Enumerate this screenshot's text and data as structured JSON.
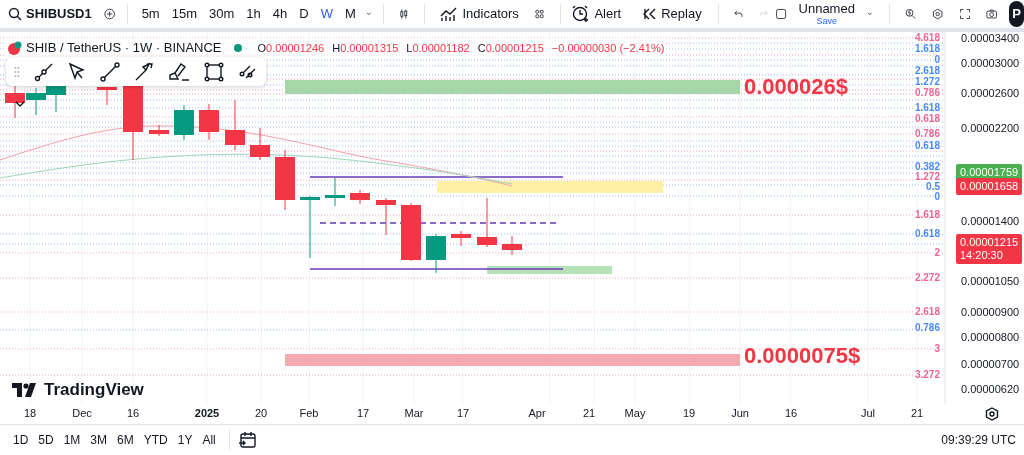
{
  "toolbar": {
    "symbol": "SHIBUSD1",
    "intervals": [
      {
        "label": "5m",
        "selected": false
      },
      {
        "label": "15m",
        "selected": false
      },
      {
        "label": "30m",
        "selected": false
      },
      {
        "label": "1h",
        "selected": false
      },
      {
        "label": "4h",
        "selected": false
      },
      {
        "label": "D",
        "selected": false
      },
      {
        "label": "W",
        "selected": true
      },
      {
        "label": "M",
        "selected": false
      }
    ],
    "indicators": "Indicators",
    "alert": "Alert",
    "replay": "Replay",
    "layout_name": "Unnamed",
    "save": "Save",
    "avatar": "P"
  },
  "legend": {
    "title": "SHIB / TetherUS · 1W · BINANCE",
    "ohlc": [
      {
        "key": "O",
        "value": "0.00001246"
      },
      {
        "key": "H",
        "value": "0.00001315"
      },
      {
        "key": "L",
        "value": "0.00001182"
      },
      {
        "key": "C",
        "value": "0.00001215"
      }
    ],
    "change": "−0.00000030 (−2.41%)"
  },
  "annotations": [
    {
      "text": "0.000026$"
    },
    {
      "text": "0.0000075$"
    }
  ],
  "fib_labels": [
    {
      "text": "4.618",
      "color": "#f06292"
    },
    {
      "text": "1.618",
      "color": "#448aff"
    },
    {
      "text": "0",
      "color": "#448aff"
    },
    {
      "text": "2.618",
      "color": "#448aff"
    },
    {
      "text": "1.272",
      "color": "#448aff"
    },
    {
      "text": "0.786",
      "color": "#f06292"
    },
    {
      "text": "1.618",
      "color": "#448aff"
    },
    {
      "text": "0.618",
      "color": "#f06292"
    },
    {
      "text": "0.786",
      "color": "#f06292"
    },
    {
      "text": "0.618",
      "color": "#448aff"
    },
    {
      "text": "0.382",
      "color": "#448aff"
    },
    {
      "text": "1.272",
      "color": "#f06292"
    },
    {
      "text": "0.5",
      "color": "#448aff"
    },
    {
      "text": "0",
      "color": "#448aff"
    },
    {
      "text": "1.618",
      "color": "#f06292"
    },
    {
      "text": "0.618",
      "color": "#448aff"
    },
    {
      "text": "2",
      "color": "#f06292"
    },
    {
      "text": "2.272",
      "color": "#f06292"
    },
    {
      "text": "2.618",
      "color": "#f06292"
    },
    {
      "text": "0.786",
      "color": "#448aff"
    },
    {
      "text": "3",
      "color": "#f06292"
    },
    {
      "text": "3.272",
      "color": "#f06292"
    }
  ],
  "price_axis": {
    "ticks": [
      "0.00003400",
      "0.00003000",
      "0.00002600",
      "0.00002200",
      "0.00001400",
      "0.00001050",
      "0.00000900",
      "0.00000800",
      "0.00000700",
      "0.00000620"
    ],
    "badges": [
      {
        "text": "0.00001759",
        "color": "#4caf50"
      },
      {
        "text": "0.00001658",
        "color": "#f23645"
      },
      {
        "text": "0.00001215",
        "countdown": "14:20:30",
        "color": "#f23645"
      }
    ]
  },
  "logo": "TradingView",
  "time_axis": [
    "18",
    "Dec",
    "16",
    "2025",
    "20",
    "Feb",
    "17",
    "Mar",
    "17",
    "Apr",
    "21",
    "May",
    "19",
    "Jun",
    "16",
    "Jul",
    "21"
  ],
  "ranges": [
    "1D",
    "5D",
    "1M",
    "3M",
    "6M",
    "YTD",
    "1Y",
    "All"
  ],
  "clock": "09:39:29 UTC"
}
